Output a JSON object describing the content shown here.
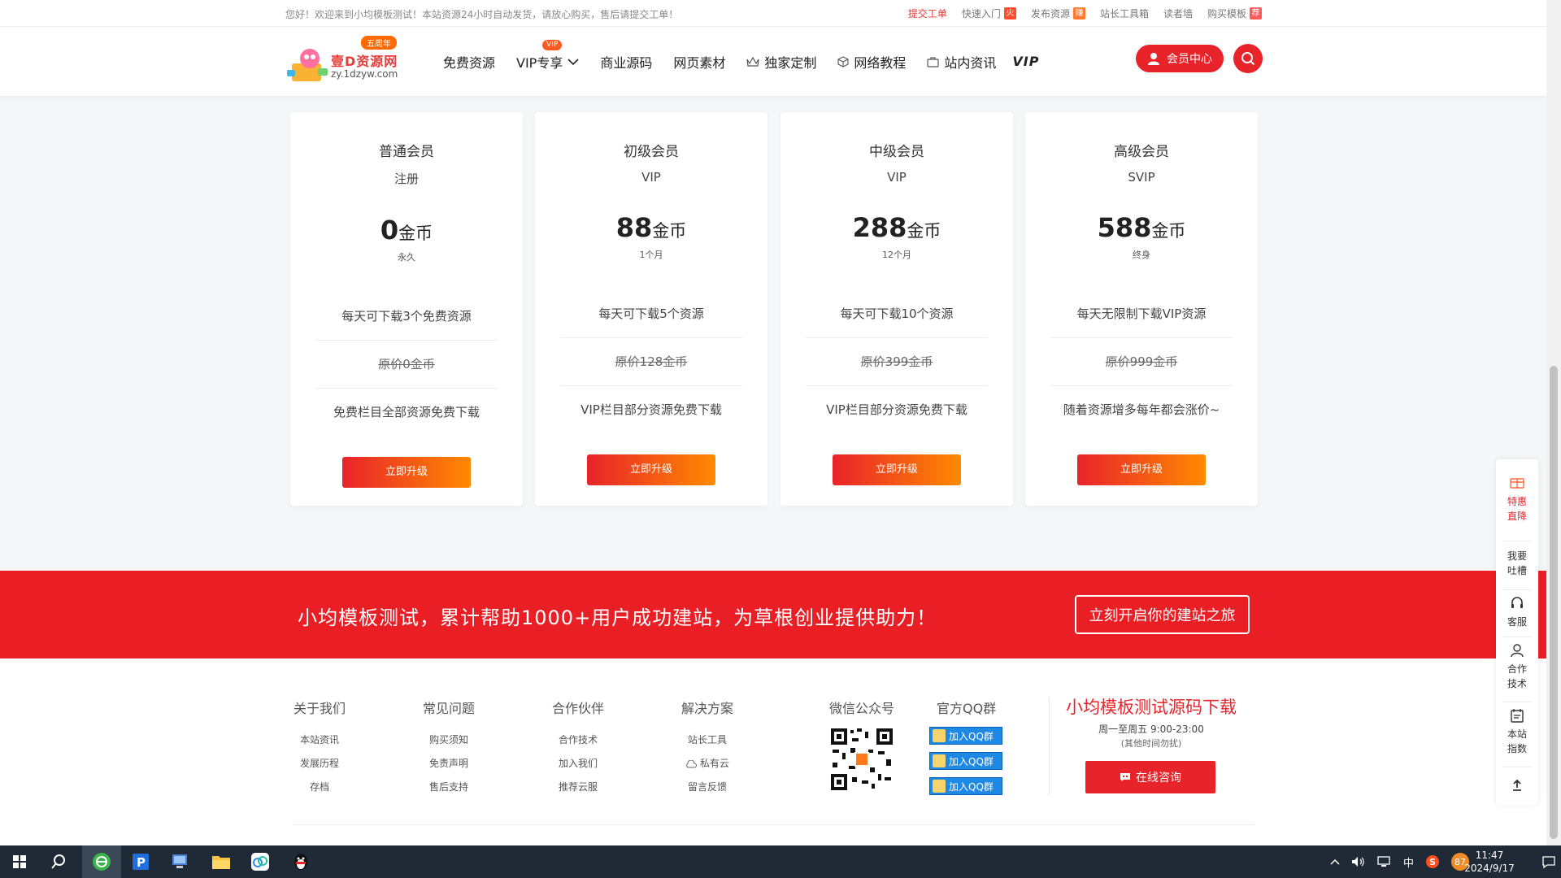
{
  "topbar": {
    "welcome": "您好！欢迎来到小均模板测试！本站资源24小时自动发货，请放心购买，售后请提交工单！",
    "links": [
      {
        "label": "提交工单",
        "highlight": true,
        "tag": ""
      },
      {
        "label": "快速入门",
        "highlight": false,
        "tag": "火"
      },
      {
        "label": "发布资源",
        "highlight": false,
        "tag": "赚"
      },
      {
        "label": "站长工具箱",
        "highlight": false,
        "tag": ""
      },
      {
        "label": "读者墙",
        "highlight": false,
        "tag": ""
      },
      {
        "label": "购买模板",
        "highlight": false,
        "tag": "荐"
      }
    ]
  },
  "header": {
    "logo_badge": "五周年",
    "logo_name": "壹D资源网",
    "logo_domain": "zy.1dzyw.com",
    "nav": [
      "免费资源",
      "VIP专享",
      "商业源码",
      "网页素材",
      "独家定制",
      "网络教程",
      "站内资讯"
    ],
    "nav_vip_badge": "VIP",
    "vip_logo": "VIP",
    "member_button": "会员中心"
  },
  "pricing": [
    {
      "title": "普通会员",
      "sub": "注册",
      "amount": "0",
      "unit": "金币",
      "period": "永久",
      "feature": "每天可下载3个免费资源",
      "original": "原价0金币",
      "note": "免费栏目全部资源免费下载",
      "button": "立即升级"
    },
    {
      "title": "初级会员",
      "sub": "VIP",
      "amount": "88",
      "unit": "金币",
      "period": "1个月",
      "feature": "每天可下载5个资源",
      "original": "原价128金币",
      "note": "VIP栏目部分资源免费下载",
      "button": "立即升级"
    },
    {
      "title": "中级会员",
      "sub": "VIP",
      "amount": "288",
      "unit": "金币",
      "period": "12个月",
      "feature": "每天可下载10个资源",
      "original": "原价399金币",
      "note": "VIP栏目部分资源免费下载",
      "button": "立即升级"
    },
    {
      "title": "高级会员",
      "sub": "SVIP",
      "amount": "588",
      "unit": "金币",
      "period": "终身",
      "feature": "每天无限制下载VIP资源",
      "original": "原价999金币",
      "note": "随着资源增多每年都会涨价~",
      "button": "立即升级"
    }
  ],
  "banner": {
    "text": "小均模板测试，累计帮助1000+用户成功建站，为草根创业提供助力！",
    "cta": "立刻开启你的建站之旅"
  },
  "footer": {
    "columns": [
      {
        "head": "关于我们",
        "links": [
          "本站资讯",
          "发展历程",
          "存档"
        ]
      },
      {
        "head": "常见问题",
        "links": [
          "购买须知",
          "免责声明",
          "售后支持"
        ]
      },
      {
        "head": "合作伙伴",
        "links": [
          "合作技术",
          "加入我们",
          "推荐云服"
        ]
      },
      {
        "head": "解决方案",
        "links": [
          "站长工具",
          "私有云",
          "留言反馈"
        ]
      }
    ],
    "wechat_head": "微信公众号",
    "qq_head": "官方QQ群",
    "qq_buttons": [
      "加入QQ群",
      "加入QQ群",
      "加入QQ群"
    ],
    "download_title": "小均模板测试源码下载",
    "hours": "周一至周五 9:00-23:00",
    "hours_note": "(其他时间勿扰)",
    "consult": "在线咨询"
  },
  "floatbar": [
    {
      "label": "特惠直降",
      "icon": "gift-icon"
    },
    {
      "label": "我要吐槽",
      "icon": "comment-icon"
    },
    {
      "label": "客服",
      "icon": "headset-icon"
    },
    {
      "label": "合作技术",
      "icon": "user-icon"
    },
    {
      "label": "本站指数",
      "icon": "calendar-icon"
    }
  ],
  "taskbar": {
    "time": "11:47",
    "date": "2024/9/17",
    "ime": "中",
    "badge": "87"
  },
  "colors": {
    "accent": "#e8232a",
    "gradient_end": "#ff8a00",
    "taskbar": "#1f2a36"
  }
}
